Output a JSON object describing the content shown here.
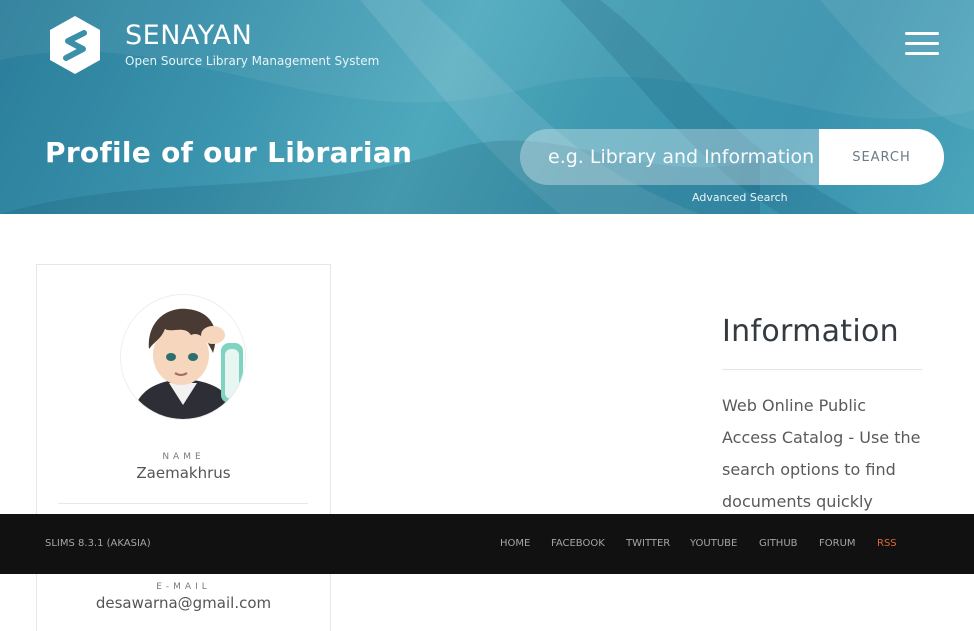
{
  "brand": {
    "title": "SENAYAN",
    "subtitle": "Open Source Library Management System",
    "logo_icon": "senayan-logo-icon"
  },
  "header": {
    "menu_icon": "hamburger-menu-icon",
    "page_title": "Profile of our Librarian"
  },
  "search": {
    "placeholder": "e.g. Library and Information",
    "button_label": "SEARCH",
    "advanced_label": "Advanced Search"
  },
  "librarian": {
    "avatar_icon": "librarian-avatar",
    "name_label": "NAME",
    "name": "Zaemakhrus",
    "email_label": "E-MAIL",
    "email": "desawarna@gmail.com"
  },
  "sidebar": {
    "title": "Information",
    "text": "Web Online Public Access Catalog - Use the search options to find documents quickly"
  },
  "footer": {
    "version": "SLIMS 8.3.1 (AKASIA)",
    "nav": [
      {
        "label": "HOME"
      },
      {
        "label": "FACEBOOK"
      },
      {
        "label": "TWITTER"
      },
      {
        "label": "YOUTUBE"
      },
      {
        "label": "GITHUB"
      },
      {
        "label": "FORUM"
      },
      {
        "label": "RSS"
      }
    ]
  },
  "colors": {
    "hero": "#3a93ad",
    "footer_bg": "#111111",
    "rss_accent": "#d86a3a"
  }
}
